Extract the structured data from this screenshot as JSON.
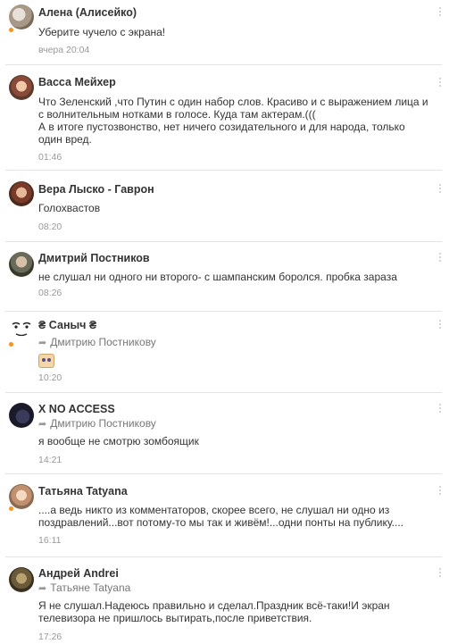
{
  "comments": [
    {
      "author": "Алена (Алисейко)",
      "reply_to": "",
      "text": "Уберите чучело с экрана!",
      "time": "вчера 20:04"
    },
    {
      "author": "Васса Мейхер",
      "reply_to": "",
      "text": "Что Зеленский ,что Путин с  один набор слов. Красиво и  с выражением лица  и с волнительным нотками в голосе. Куда там актерам.(((",
      "text2": "А в итоге пустозвонство, нет ничего созидательного и для народа, только один вред.",
      "time": "01:46"
    },
    {
      "author": "Вера Лыско - Гаврон",
      "reply_to": "",
      "text": "Голохвастов",
      "time": "08:20"
    },
    {
      "author": "Дмитрий Постников",
      "reply_to": "",
      "text": "не слушал ни одного ни второго- с шампанским боролся. пробка зараза",
      "time": "08:26"
    },
    {
      "author": "₴ Саныч ₴",
      "reply_to": "Дмитрию Постникову",
      "text": "",
      "time": "10:20"
    },
    {
      "author": "X NO ACCESS",
      "reply_to": "Дмитрию Постникову",
      "text": "я вообще не смотрю зомбоящик",
      "time": "14:21"
    },
    {
      "author": "Татьяна Tatyana",
      "reply_to": "",
      "text": "....а ведь никто из комментаторов, скорее всего, не слушал ни одно из поздравлений...вот потому-то мы так и живём!...одни понты на публику....",
      "time": "16:11"
    },
    {
      "author": "Андрей Andrei",
      "reply_to": "Татьяне Tatyana",
      "text": "Я не слушал.Надеюсь правильно и сделал.Праздник всё-таки!И экран телевизора не пришлось вытирать,после приветствия.",
      "time": "17:26"
    }
  ],
  "colors": {
    "online_dot": "#f7931e",
    "divider": "#e3e3e3",
    "meta": "#999999"
  }
}
